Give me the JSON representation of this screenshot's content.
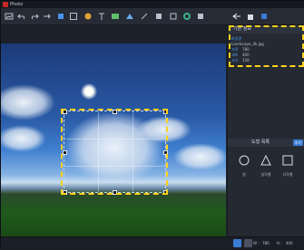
{
  "app": {
    "title": "Photo"
  },
  "toolbar": {
    "icons": [
      "image-icon",
      "undo-icon",
      "redo-icon",
      "arrow-icon",
      "crop-icon",
      "frame-icon",
      "sticker-icon",
      "text-icon",
      "gradient-icon",
      "filter-icon",
      "draw-icon",
      "zoom-icon",
      "palette-icon",
      "back-icon",
      "upload-icon",
      "save-icon"
    ]
  },
  "info_panel": {
    "title": "기본 정보",
    "file_name_label": "파일명",
    "file_name": "Landscape_4k.jpg",
    "width_label": "가로",
    "width_value": "780",
    "height_label": "세로",
    "height_value": "400",
    "size_label": "크기",
    "size_value": "158"
  },
  "shape_panel": {
    "title": "도형 목록",
    "add_label": "추가",
    "shapes": [
      {
        "label": "원"
      },
      {
        "label": "삼각형"
      },
      {
        "label": "사각형"
      }
    ]
  },
  "statusbar": {
    "w_label": "W :",
    "w_value": "780",
    "h_label": "H :",
    "h_value": "400"
  },
  "colors": {
    "highlight": "#ffd21a",
    "accent": "#3a7bd5",
    "label_blue": "#4fa3ff"
  }
}
